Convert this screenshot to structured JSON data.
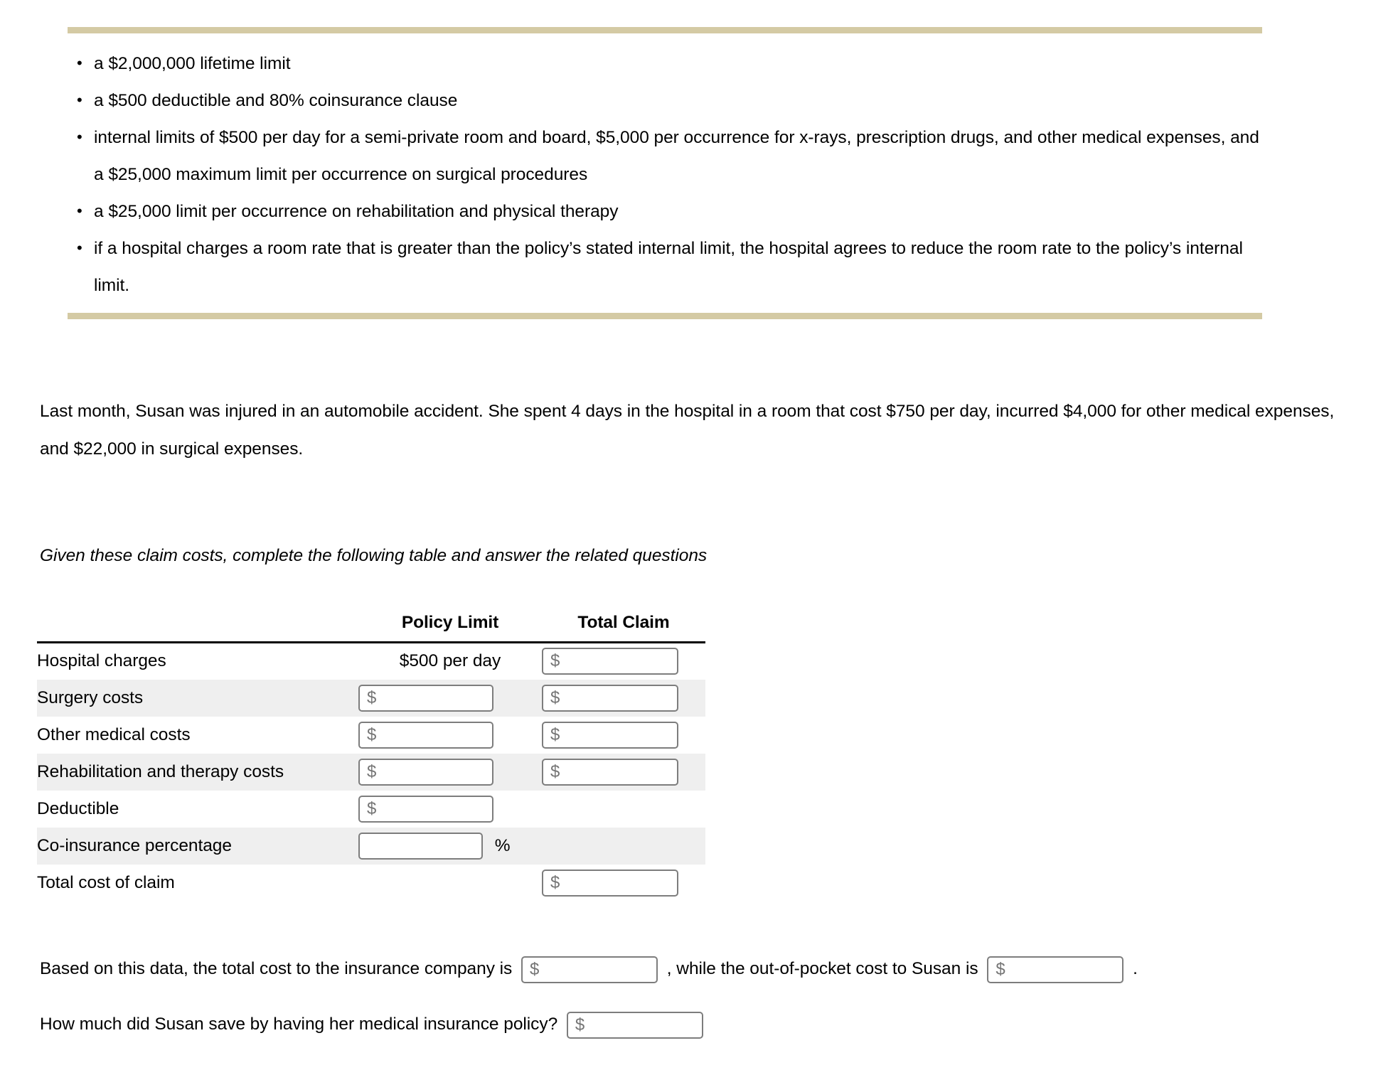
{
  "policy": {
    "bullets": [
      "a $2,000,000 lifetime limit",
      "a $500 deductible and 80% coinsurance clause",
      "internal limits of $500 per day for a semi-private room and board, $5,000 per occurrence for x-rays, prescription drugs, and other medical expenses, and a $25,000 maximum limit per occurrence on surgical procedures",
      "a $25,000 limit per occurrence on rehabilitation and physical therapy",
      "if a hospital charges a room rate that is greater than the policy’s stated internal limit, the hospital agrees to reduce the room rate to the policy’s internal limit."
    ],
    "divider_color": "#d4caa4"
  },
  "narrative": "Last month, Susan was injured in an automobile accident. She spent 4 days in the hospital in a room that cost $750 per day, incurred $4,000 for other medical expenses, and $22,000 in surgical expenses.",
  "instruction": "Given these claim costs, complete the following table and answer the related questions",
  "table": {
    "headers": {
      "label": "",
      "policy_limit": "Policy Limit",
      "total_claim": "Total Claim"
    },
    "placeholder_dollar": "$",
    "percent_symbol": "%",
    "rows": [
      {
        "label": "Hospital charges",
        "policy_limit_text": "$500 per day",
        "policy_limit_input": false,
        "total_claim_input": true,
        "total_claim_value": "",
        "striped": false
      },
      {
        "label": "Surgery costs",
        "policy_limit_text": "",
        "policy_limit_input": true,
        "policy_limit_value": "",
        "total_claim_input": true,
        "total_claim_value": "",
        "striped": true
      },
      {
        "label": "Other medical costs",
        "policy_limit_text": "",
        "policy_limit_input": true,
        "policy_limit_value": "",
        "total_claim_input": true,
        "total_claim_value": "",
        "striped": false
      },
      {
        "label": "Rehabilitation and therapy costs",
        "policy_limit_text": "",
        "policy_limit_input": true,
        "policy_limit_value": "",
        "total_claim_input": true,
        "total_claim_value": "",
        "striped": true
      },
      {
        "label": "Deductible",
        "policy_limit_text": "",
        "policy_limit_input": true,
        "policy_limit_value": "",
        "total_claim_input": false,
        "striped": false
      },
      {
        "label": "Co-insurance percentage",
        "policy_limit_text": "",
        "policy_limit_input": true,
        "policy_limit_value": "",
        "percent": true,
        "total_claim_input": false,
        "striped": true
      },
      {
        "label": "Total cost of claim",
        "policy_limit_text": "",
        "policy_limit_input": false,
        "total_claim_input": true,
        "total_claim_value": "",
        "striped": false
      }
    ]
  },
  "questions": {
    "q1_part1": "Based on this data, the total cost to the insurance company is",
    "q1_part2": ", while the out-of-pocket cost to Susan is",
    "q1_part3": ".",
    "q1_input_a_value": "",
    "q1_input_b_value": "",
    "q2_text": "How much did Susan save by having her medical insurance policy?",
    "q2_input_value": ""
  }
}
